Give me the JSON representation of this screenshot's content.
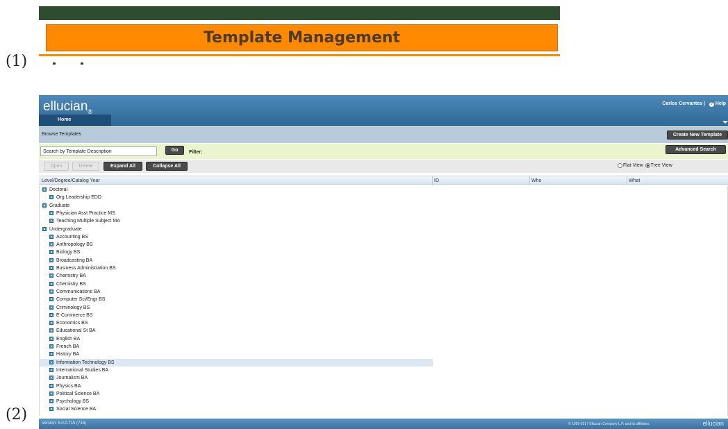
{
  "markers": {
    "one": "(1)",
    "two": "(2)"
  },
  "banner": {
    "title": "Template Management"
  },
  "app": {
    "logo": "ellucian",
    "logo_mark": "®",
    "home_tab": "Home",
    "user_name": "Carlos Cervantes",
    "separator": "|",
    "help_label": "Help",
    "help_icon_glyph": "?",
    "browse_title": "Browse Templates",
    "create_button": "Create New Template",
    "search_value": "Search by Template Description",
    "go_button": "Go",
    "filter_label": "Filter:",
    "advanced_button": "Advanced Search",
    "actions": {
      "open": "Open",
      "delete": "Delete",
      "expand": "Expand All",
      "collapse": "Collapse All"
    },
    "view": {
      "flat": "Flat View",
      "tree": "Tree View",
      "selected": "Tree View"
    },
    "columns": [
      "Level/Degree/Catalog Year",
      "ID",
      "Who",
      "What"
    ],
    "tree": [
      {
        "label": "Doctoral",
        "level": 0
      },
      {
        "label": "Org Leadership EDD",
        "level": 1
      },
      {
        "label": "Graduate",
        "level": 0
      },
      {
        "label": "Physician Asst Practice MS",
        "level": 1
      },
      {
        "label": "Teaching Multiple Subject MA",
        "level": 1
      },
      {
        "label": "Undergraduate",
        "level": 0
      },
      {
        "label": "Accounting BS",
        "level": 1
      },
      {
        "label": "Anthropology BS",
        "level": 1
      },
      {
        "label": "Biology BS",
        "level": 1
      },
      {
        "label": "Broadcasting BA",
        "level": 1
      },
      {
        "label": "Business Administration BS",
        "level": 1
      },
      {
        "label": "Chemistry BA",
        "level": 1
      },
      {
        "label": "Chemistry BS",
        "level": 1
      },
      {
        "label": "Communications BA",
        "level": 1
      },
      {
        "label": "Computer Sci/Engr BS",
        "level": 1
      },
      {
        "label": "Criminology BS",
        "level": 1
      },
      {
        "label": "E-Commerce BS",
        "level": 1
      },
      {
        "label": "Economics BS",
        "level": 1
      },
      {
        "label": "Educational St BA",
        "level": 1
      },
      {
        "label": "English BA",
        "level": 1
      },
      {
        "label": "French BA",
        "level": 1
      },
      {
        "label": "History BA",
        "level": 1
      },
      {
        "label": "Information Technology BS",
        "level": 1,
        "selected": true
      },
      {
        "label": "International Studies BA",
        "level": 1
      },
      {
        "label": "Journalism BA",
        "level": 1
      },
      {
        "label": "Physics BA",
        "level": 1
      },
      {
        "label": "Political Science BA",
        "level": 1
      },
      {
        "label": "Psychology BS",
        "level": 1
      },
      {
        "label": "Social Science BA",
        "level": 1
      }
    ],
    "footer": {
      "version": "Version: 5.0.0.715 (715)",
      "copyright": "© 1995-2017 Ellucian Company L.P. and its affiliates.",
      "brand": "ellucian"
    }
  },
  "colors": {
    "banner_orange": "#ff8a00",
    "banner_dark": "#2d4d2e",
    "header_blue": "#2f6896",
    "filter_bar": "#eaf4cd",
    "tree_node": "#3c8fd1",
    "selected_row": "#dce8f4"
  }
}
